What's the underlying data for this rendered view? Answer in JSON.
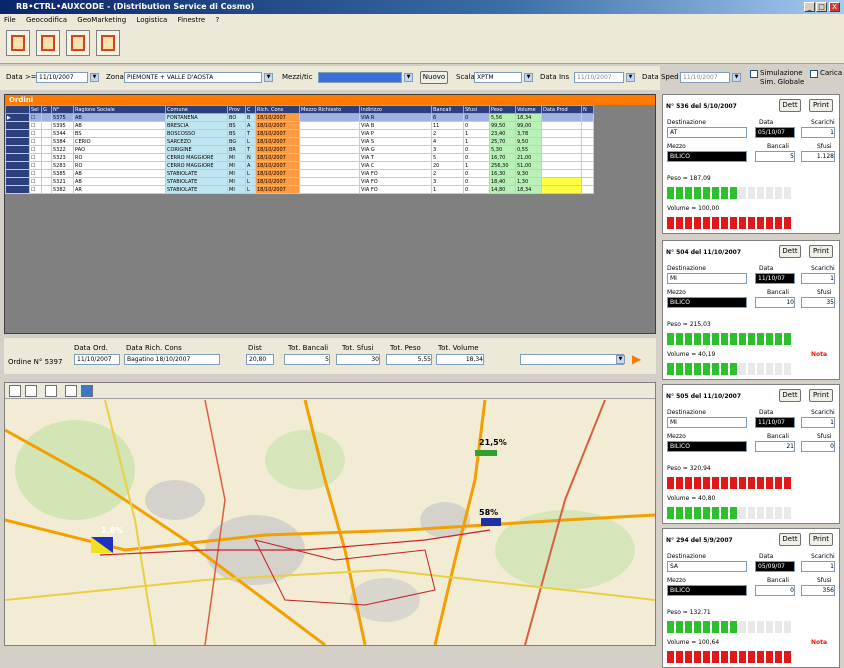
{
  "window": {
    "title": "RB•CTRL•AUXCODE - (Distribution Service di Cosmo)",
    "min": "_",
    "max": "□",
    "close": "X"
  },
  "menu": [
    "File",
    "Geocodifica",
    "GeoMarketing",
    "Logistica",
    "Finestre",
    "?"
  ],
  "filter": {
    "date_label": "Data >=",
    "date_value": "11/10/2007",
    "zone_label": "Zona",
    "zone_value": "PIEMONTE + VALLE D'AOSTA",
    "mezzo_label": "Mezzi/tic",
    "mezzo_value": "",
    "nuovo_btn": "Nuovo",
    "scala_label": "Scala",
    "scala_value": "XPTM",
    "data_ins_label": "Data Ins",
    "data_ins_value": "11/10/2007",
    "data_sped_label": "Data Sped",
    "data_sped_value": "11/10/2007",
    "simulazione": "Simulazione",
    "sim_globale": "Sim. Globale",
    "carica": "Carica"
  },
  "grid": {
    "header_label": "Ordini",
    "columns": [
      "Sel",
      "G",
      "N°",
      "Ragione Sociale",
      "Comune",
      "Prov",
      "C",
      "Rich. Cons",
      "Mezzo Richiesto",
      "Indirizzo",
      "Bancali",
      "Sfusi",
      "Peso",
      "Volume",
      "Data Prod",
      "N"
    ],
    "rows": [
      {
        "n": "5375",
        "rag": "AB",
        "com": "FONTANENA",
        "prov": "BO",
        "c": "B",
        "rich": "18/10/2007",
        "ind": "VIA R",
        "ban": "6",
        "sfu": "0",
        "peso": "5,56",
        "vol": "18,34"
      },
      {
        "n": "5395",
        "rag": "AB",
        "com": "BRESCIA",
        "prov": "BS",
        "c": "A",
        "rich": "18/10/2007",
        "ind": "VIA B",
        "ban": "11",
        "sfu": "0",
        "peso": "99,50",
        "vol": "99,00"
      },
      {
        "n": "5344",
        "rag": "BS",
        "com": "BOSCOSSO",
        "prov": "BS",
        "c": "T",
        "rich": "18/10/2007",
        "ind": "VIA P",
        "ban": "2",
        "sfu": "1",
        "peso": "23,40",
        "vol": "3,78"
      },
      {
        "n": "5384",
        "rag": "CERIO",
        "com": "SARCEZO",
        "prov": "BG",
        "c": "L",
        "rich": "18/10/2007",
        "ind": "VIA S",
        "ban": "4",
        "sfu": "1",
        "peso": "25,70",
        "vol": "9,50"
      },
      {
        "n": "5322",
        "rag": "PAO",
        "com": "CORIGINE",
        "prov": "BR",
        "c": "T",
        "rich": "18/10/2007",
        "ind": "VIA G",
        "ban": "3",
        "sfu": "0",
        "peso": "5,30",
        "vol": "0,55"
      },
      {
        "n": "5323",
        "rag": "RO",
        "com": "CERRO MAGGIORE",
        "prov": "MI",
        "c": "N",
        "rich": "18/10/2007",
        "ind": "VIA T",
        "ban": "5",
        "sfu": "0",
        "peso": "16,70",
        "vol": "21,00"
      },
      {
        "n": "5283",
        "rag": "RO",
        "com": "CERRO MAGGIORE",
        "prov": "MI",
        "c": "A",
        "rich": "18/10/2007",
        "ind": "VIA C",
        "ban": "20",
        "sfu": "1",
        "peso": "256,30",
        "vol": "51,00"
      },
      {
        "n": "5385",
        "rag": "AB",
        "com": "STABIOLATE",
        "prov": "MI",
        "c": "L",
        "rich": "18/10/2007",
        "ind": "VIA FO",
        "ban": "2",
        "sfu": "0",
        "peso": "16,30",
        "vol": "9,30"
      },
      {
        "n": "5321",
        "rag": "AB",
        "com": "STABIOLATE",
        "prov": "MI",
        "c": "L",
        "rich": "18/10/2007",
        "ind": "VIA FO",
        "ban": "3",
        "sfu": "0",
        "peso": "18,40",
        "vol": "1,30"
      },
      {
        "n": "5382",
        "rag": "AR",
        "com": "STABIOLATE",
        "prov": "MI",
        "c": "L",
        "rich": "18/10/2007",
        "ind": "VIA FO",
        "ban": "1",
        "sfu": "0",
        "peso": "14,80",
        "vol": "18,34"
      }
    ]
  },
  "summary": {
    "order_label": "Ordine N° 5397",
    "data_ord_label": "Data Ord.",
    "data_ord": "11/10/2007",
    "data_rich_label": "Data Rich. Cons",
    "data_rich": "Bagatino 18/10/2007",
    "dist_label": "Dist",
    "dist": "20,80",
    "tot_ban_label": "Tot. Bancali",
    "tot_ban": "5",
    "tot_sfu_label": "Tot. Sfusi",
    "tot_sfu": "30",
    "tot_peso_label": "Tot. Peso",
    "tot_peso": "5,55",
    "tot_vol_label": "Tot. Volume",
    "tot_vol": "18,34"
  },
  "map": {
    "labels": [
      "21,5%",
      "58%",
      "1,8%"
    ]
  },
  "cards": [
    {
      "title": "N° 536 del 5/10/2007",
      "btn1": "Dett",
      "btn2": "Print",
      "destinazione_label": "Destinazione",
      "destinazione": "AT",
      "data_label": "Data",
      "data": "05/10/07",
      "scarichi_label": "Scarichi",
      "scarichi": "1",
      "mezzo_label": "Mezzo",
      "mezzo": "BILICO",
      "bancali_label": "Bancali",
      "bancali": "5",
      "sfusi_label": "Sfusi",
      "sfusi": "1.128",
      "peso": "Peso = 187,09",
      "volume": "Volume = 100,00",
      "peso_fill": 0.6,
      "peso_color": "#2cc02c",
      "vol_fill": 1.0,
      "vol_color": "#e01818",
      "nota": ""
    },
    {
      "title": "N° 504 del 11/10/2007",
      "btn1": "Dett",
      "btn2": "Print",
      "destinazione_label": "Destinazione",
      "destinazione": "MI",
      "data_label": "Data",
      "data": "11/10/07",
      "scarichi_label": "Scarichi",
      "scarichi": "1",
      "mezzo_label": "Mezzo",
      "mezzo": "BILICO",
      "bancali_label": "Bancali",
      "bancali": "10",
      "sfusi_label": "Sfusi",
      "sfusi": "35",
      "peso": "Peso = 215,03",
      "volume": "Volume = 40,19",
      "peso_fill": 1.0,
      "peso_color": "#2cc02c",
      "vol_fill": 0.55,
      "vol_color": "#2cc02c",
      "nota": "Nota"
    },
    {
      "title": "N° 505 del 11/10/2007",
      "btn1": "Dett",
      "btn2": "Print",
      "destinazione_label": "Destinazione",
      "destinazione": "MI",
      "data_label": "Data",
      "data": "11/10/07",
      "scarichi_label": "Scarichi",
      "scarichi": "1",
      "mezzo_label": "Mezzo",
      "mezzo": "BILICO",
      "bancali_label": "Bancali",
      "bancali": "21",
      "sfusi_label": "Sfusi",
      "sfusi": "0",
      "peso": "Peso = 320,94",
      "volume": "Volume = 40,80",
      "peso_fill": 1.0,
      "peso_color": "#e01818",
      "vol_fill": 0.55,
      "vol_color": "#2cc02c",
      "nota": ""
    },
    {
      "title": "N° 294 del 5/9/2007",
      "btn1": "Dett",
      "btn2": "Print",
      "destinazione_label": "Destinazione",
      "destinazione": "SA",
      "data_label": "Data",
      "data": "05/09/07",
      "scarichi_label": "Scarichi",
      "scarichi": "1",
      "mezzo_label": "Mezzo",
      "mezzo": "BILICO",
      "bancali_label": "Bancali",
      "bancali": "0",
      "sfusi_label": "Sfusi",
      "sfusi": "356",
      "peso": "Peso = 132,71",
      "volume": "Volume = 100,64",
      "peso_fill": 0.55,
      "peso_color": "#2cc02c",
      "vol_fill": 1.0,
      "vol_color": "#e01818",
      "nota": "Nota"
    }
  ],
  "colors": {
    "header": "#2a3f7c",
    "orange": "#ff7a00",
    "ok": "#2cc02c",
    "over": "#e01818"
  }
}
